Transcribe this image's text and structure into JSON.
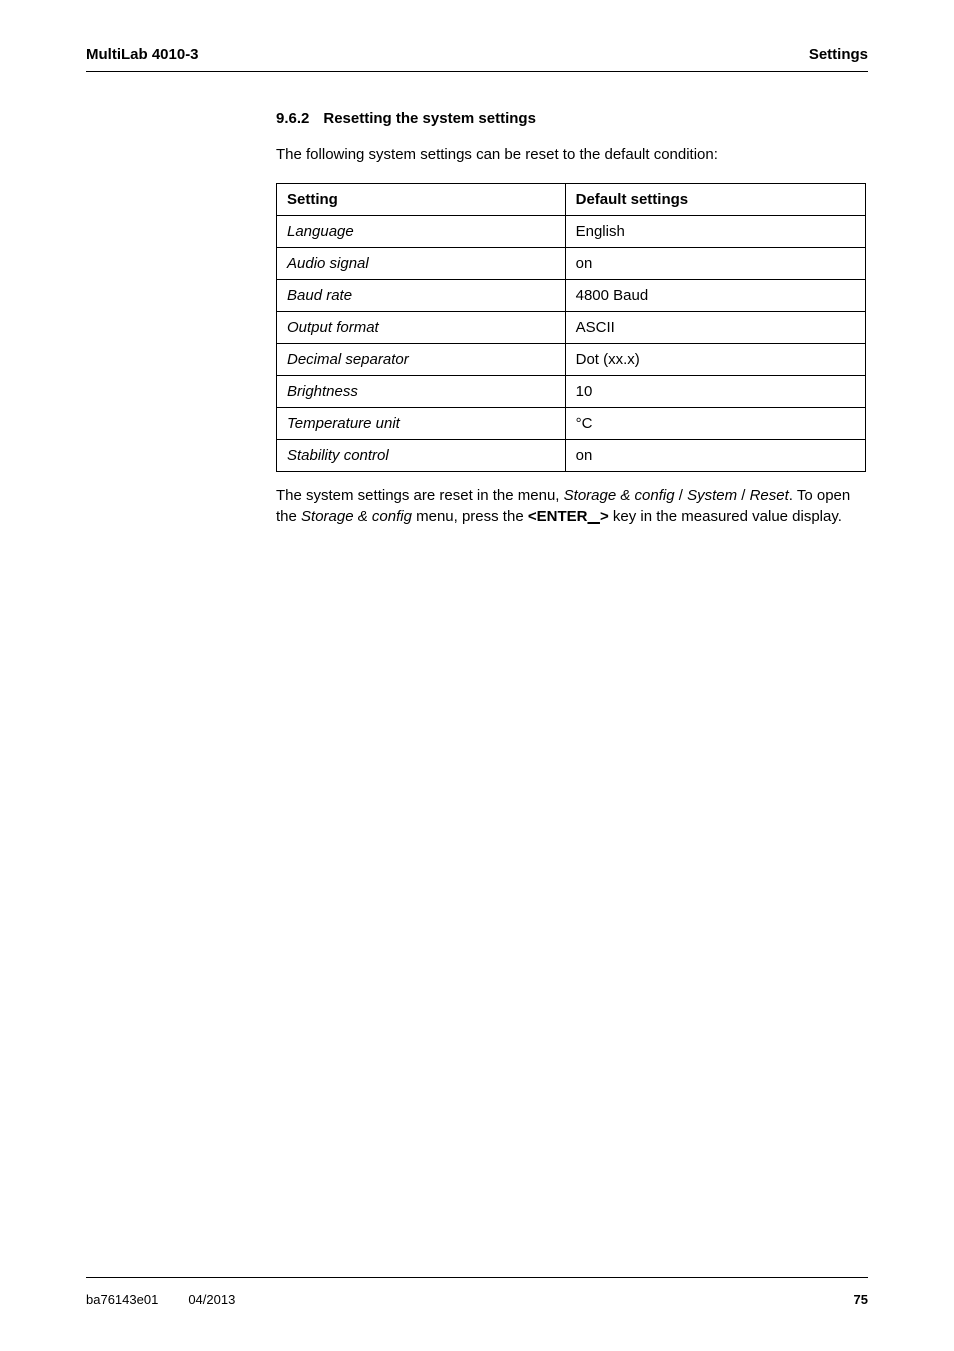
{
  "header": {
    "left": "MultiLab 4010-3",
    "right": "Settings"
  },
  "section": {
    "number": "9.6.2",
    "title": "Resetting the system settings",
    "intro": "The following system settings can be reset to the default condition:",
    "table": {
      "col1_header": "Setting",
      "col2_header": "Default settings",
      "rows": [
        {
          "setting": "Language",
          "default": "English"
        },
        {
          "setting": "Audio signal",
          "default": "on"
        },
        {
          "setting": "Baud rate",
          "default": "4800 Baud"
        },
        {
          "setting": "Output format",
          "default": "ASCII"
        },
        {
          "setting": "Decimal separator",
          "default": "Dot (xx.x)"
        },
        {
          "setting": "Brightness",
          "default": "10"
        },
        {
          "setting": "Temperature unit",
          "default": "°C"
        },
        {
          "setting": "Stability control",
          "default": "on"
        }
      ]
    },
    "outro": {
      "part1": "The system settings are reset in the menu, ",
      "menu1": "Storage & config",
      "sep1": " / ",
      "menu2": "System",
      "sep2": " / ",
      "menu3": "Reset",
      "part2": ". To open the ",
      "menu4": "Storage & config",
      "part3": " menu, press the ",
      "key_open": "<ENTER",
      "key_underline": "   ",
      "key_close": ">",
      "part4": " key in the measured value display."
    }
  },
  "footer": {
    "doc_id": "ba76143e01",
    "date": "04/2013",
    "page": "75"
  }
}
